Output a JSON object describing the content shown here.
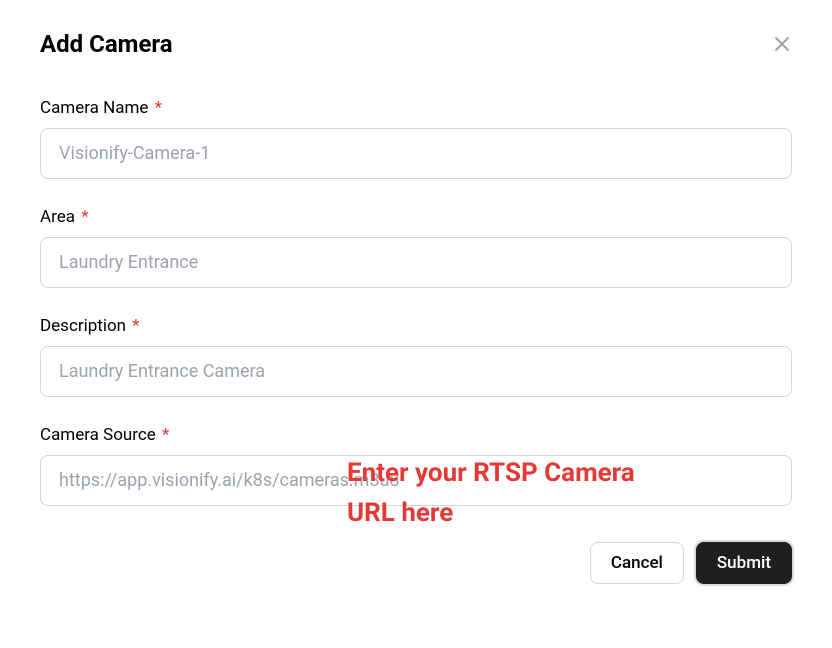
{
  "modal": {
    "title": "Add Camera"
  },
  "form": {
    "camera_name": {
      "label": "Camera Name",
      "required": "*",
      "placeholder": "Visionify-Camera-1"
    },
    "area": {
      "label": "Area",
      "required": "*",
      "placeholder": "Laundry Entrance"
    },
    "description": {
      "label": "Description",
      "required": "*",
      "placeholder": "Laundry Entrance Camera"
    },
    "camera_source": {
      "label": "Camera Source",
      "required": "*",
      "placeholder": "https://app.visionify.ai/k8s/cameras.m3u8"
    }
  },
  "annotation": {
    "line1": "Enter your RTSP Camera",
    "line2": "URL here"
  },
  "buttons": {
    "cancel": "Cancel",
    "submit": "Submit"
  }
}
